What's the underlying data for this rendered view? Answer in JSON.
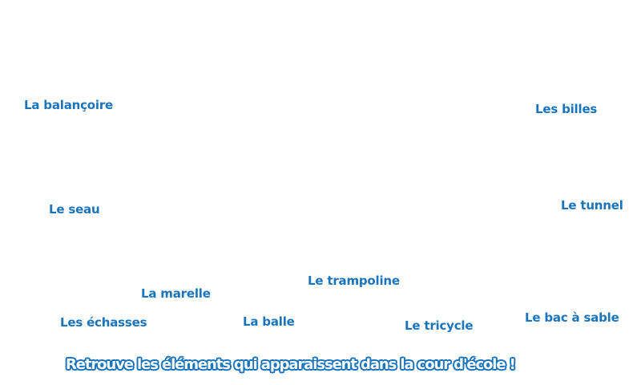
{
  "colors": {
    "label": "#1a74bb",
    "instruction_fill": "#ffffff",
    "instruction_outline": "#1a74bb",
    "background": "#ffffff"
  },
  "items": {
    "balancoire": "La balançoire",
    "billes": "Les billes",
    "seau": "Le seau",
    "tunnel": "Le tunnel",
    "trampoline": "Le trampoline",
    "marelle": "La marelle",
    "echasses": "Les échasses",
    "balle": "La balle",
    "tricycle": "Le tricycle",
    "bac_a_sable": "Le bac à sable"
  },
  "instruction": "Retrouve les éléments qui apparaissent dans la cour d'école !"
}
